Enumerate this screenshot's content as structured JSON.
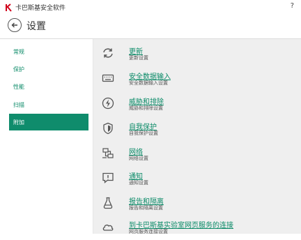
{
  "window": {
    "title": "卡巴斯基安全软件",
    "help_label": "?"
  },
  "header": {
    "title": "设置"
  },
  "sidebar": {
    "items": [
      {
        "label": "常规"
      },
      {
        "label": "保护"
      },
      {
        "label": "性能"
      },
      {
        "label": "扫描"
      },
      {
        "label": "附加"
      }
    ],
    "active_index": 4
  },
  "settings": [
    {
      "title": "更新",
      "subtitle": "更新设置",
      "icon": "refresh-icon"
    },
    {
      "title": "安全数据输入",
      "subtitle": "安全数据输入设置",
      "icon": "keyboard-icon"
    },
    {
      "title": "威胁和排除",
      "subtitle": "威胁和排除设置",
      "icon": "lightning-icon"
    },
    {
      "title": "自我保护",
      "subtitle": "自我保护设置",
      "icon": "shield-icon"
    },
    {
      "title": "网络",
      "subtitle": "网络设置",
      "icon": "network-icon"
    },
    {
      "title": "通知",
      "subtitle": "通知设置",
      "icon": "notification-icon"
    },
    {
      "title": "报告和隔离",
      "subtitle": "报告和隔离设置",
      "icon": "flask-icon"
    },
    {
      "title": "到卡巴斯基实验室网页服务的连接",
      "subtitle": "网页服务连接设置",
      "icon": "cloud-icon"
    }
  ],
  "colors": {
    "accent": "#0f8c6c",
    "link": "#0a8a67",
    "content_bg": "#efefef"
  }
}
